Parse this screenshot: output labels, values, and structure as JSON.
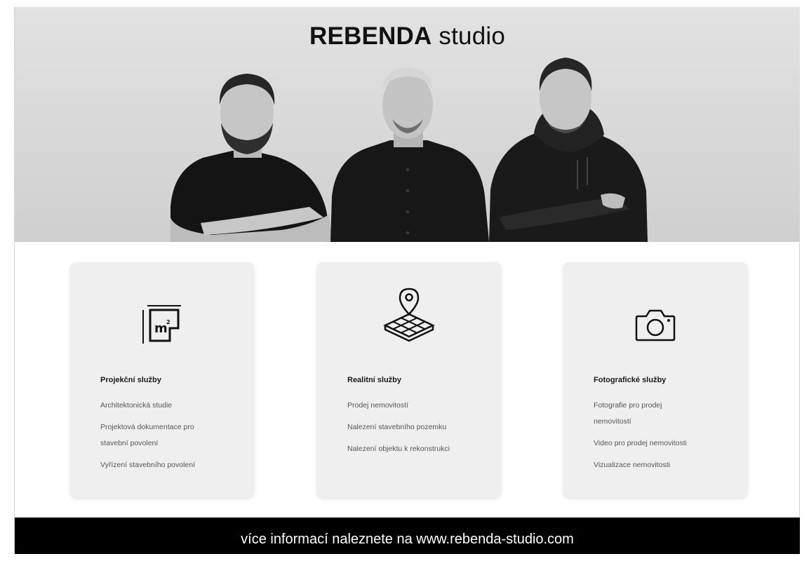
{
  "hero": {
    "brand": "REBENDA",
    "studio": "studio"
  },
  "cards": [
    {
      "icon": "floor-plan-m2-icon",
      "title": "Projekční služby",
      "items": [
        "Architektonická studie",
        "Projektová dokumentace pro stavební povolení",
        "Vyřízení stavebního povolení"
      ]
    },
    {
      "icon": "map-pin-grid-icon",
      "title": "Realitní služby",
      "items": [
        "Prodej nemovitostí",
        "Nalezení stavebního pozemku",
        "Nalezení objektu k rekonstrukci"
      ]
    },
    {
      "icon": "camera-icon",
      "title": "Fotografické služby",
      "items": [
        "Fotografie pro prodej nemovitostí",
        "Video pro prodej nemovitosti",
        "Vizualizace nemovitosti"
      ]
    }
  ],
  "footer": {
    "text": "více informací naleznete na www.rebenda-studio.com"
  },
  "colors": {
    "footer_bg": "#000000",
    "card_bg": "#efefef",
    "text_dark": "#111111"
  }
}
